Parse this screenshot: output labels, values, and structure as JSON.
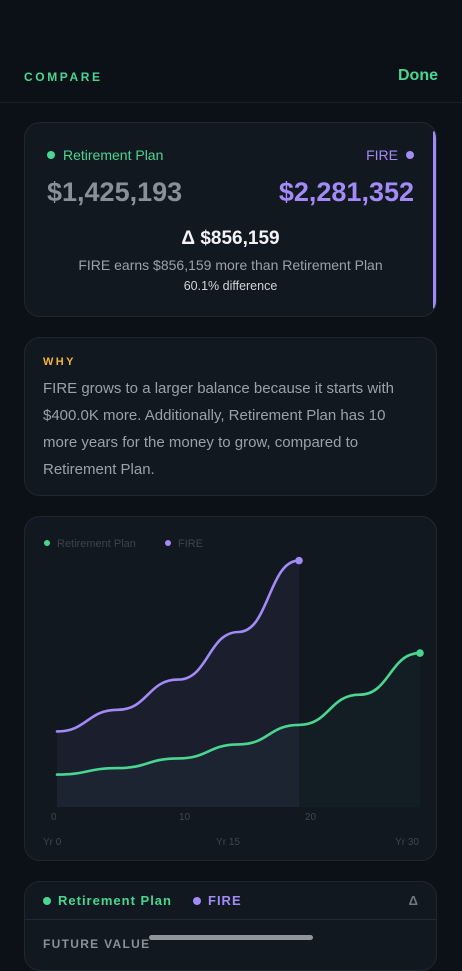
{
  "header": {
    "title": "COMPARE",
    "done_label": "Done"
  },
  "summary": {
    "plan_a": {
      "name": "Retirement Plan",
      "value": "$1,425,193",
      "color": "#4ad691"
    },
    "plan_b": {
      "name": "FIRE",
      "value": "$2,281,352",
      "color": "#a28bf7"
    },
    "delta": "Δ $856,159",
    "delta_text": "FIRE earns $856,159 more than Retirement Plan",
    "difference_pct": "60.1% difference"
  },
  "why": {
    "label": "WHY",
    "text": "FIRE grows to a larger balance because it starts with $400.0K more. Additionally, Retirement Plan has 10 more years for the money to grow, compared to Retirement Plan."
  },
  "chart_data": {
    "type": "line",
    "legend": [
      "Retirement Plan",
      "FIRE"
    ],
    "inner_ticks": [
      "0",
      "10",
      "20"
    ],
    "x_labels": [
      "Yr 0",
      "Yr 15",
      "Yr 30"
    ],
    "xlim": [
      0,
      30
    ],
    "series": [
      {
        "name": "Retirement Plan",
        "color": "#4ad691",
        "x": [
          0,
          5,
          10,
          15,
          20,
          25,
          30
        ],
        "y": [
          300000,
          360000,
          450000,
          580000,
          760000,
          1040000,
          1425193
        ]
      },
      {
        "name": "FIRE",
        "color": "#a28bf7",
        "x": [
          0,
          5,
          10,
          15,
          20
        ],
        "y": [
          700000,
          900000,
          1180000,
          1620000,
          2281352
        ]
      }
    ],
    "ylim": [
      0,
      2500000
    ]
  },
  "table": {
    "col_a": "Retirement Plan",
    "col_b": "FIRE",
    "col_delta": "Δ",
    "row_label": "FUTURE VALUE"
  }
}
